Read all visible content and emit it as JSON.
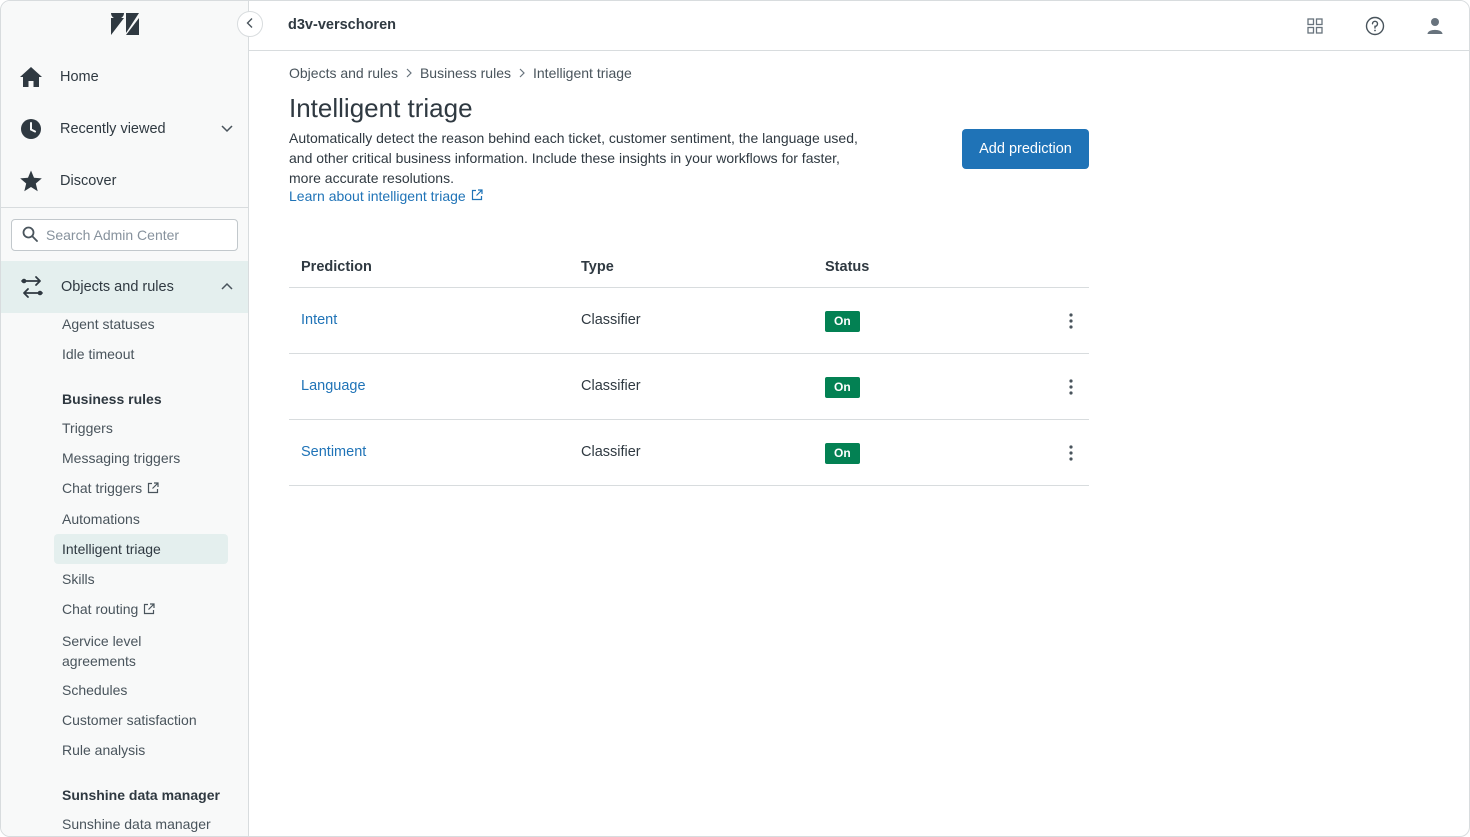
{
  "topbar": {
    "account_name": "d3v-verschoren",
    "icons": [
      "products-grid-icon",
      "help-icon",
      "user-profile-icon"
    ]
  },
  "sidebar": {
    "nav": [
      {
        "label": "Home",
        "icon": "home-icon"
      },
      {
        "label": "Recently viewed",
        "icon": "clock-icon"
      },
      {
        "label": "Discover",
        "icon": "star-icon"
      }
    ],
    "search_placeholder": "Search Admin Center",
    "section": {
      "label": "Objects and rules",
      "icon": "objects-rules-icon"
    },
    "items": {
      "agent_statuses": "Agent statuses",
      "idle_timeout": "Idle timeout",
      "business_rules": "Business rules",
      "triggers": "Triggers",
      "messaging_triggers": "Messaging triggers",
      "chat_triggers": "Chat triggers",
      "automations": "Automations",
      "intelligent_triage": "Intelligent triage",
      "skills": "Skills",
      "chat_routing": "Chat routing",
      "sla_line1": "Service level",
      "sla_line2": "agreements",
      "schedules": "Schedules",
      "customer_satisfaction": "Customer satisfaction",
      "rule_analysis": "Rule analysis",
      "sunshine_group": "Sunshine data manager",
      "sunshine_item": "Sunshine data manager"
    }
  },
  "main": {
    "breadcrumb": [
      "Objects and rules",
      "Business rules",
      "Intelligent triage"
    ],
    "title": "Intelligent triage",
    "description": "Automatically detect the reason behind each ticket, customer sentiment, the language used, and other critical business information. Include these insights in your workflows for faster, more accurate resolutions.",
    "learn_link": "Learn about intelligent triage",
    "add_button": "Add prediction",
    "table": {
      "headers": [
        "Prediction",
        "Type",
        "Status"
      ],
      "rows": [
        {
          "prediction": "Intent",
          "type": "Classifier",
          "status": "On"
        },
        {
          "prediction": "Language",
          "type": "Classifier",
          "status": "On"
        },
        {
          "prediction": "Sentiment",
          "type": "Classifier",
          "status": "On"
        }
      ]
    }
  },
  "colors": {
    "brand_blue": "#1f73b7",
    "status_green": "#038153",
    "active_bg": "#e4efee",
    "sidebar_bg": "#f8f9f9"
  }
}
